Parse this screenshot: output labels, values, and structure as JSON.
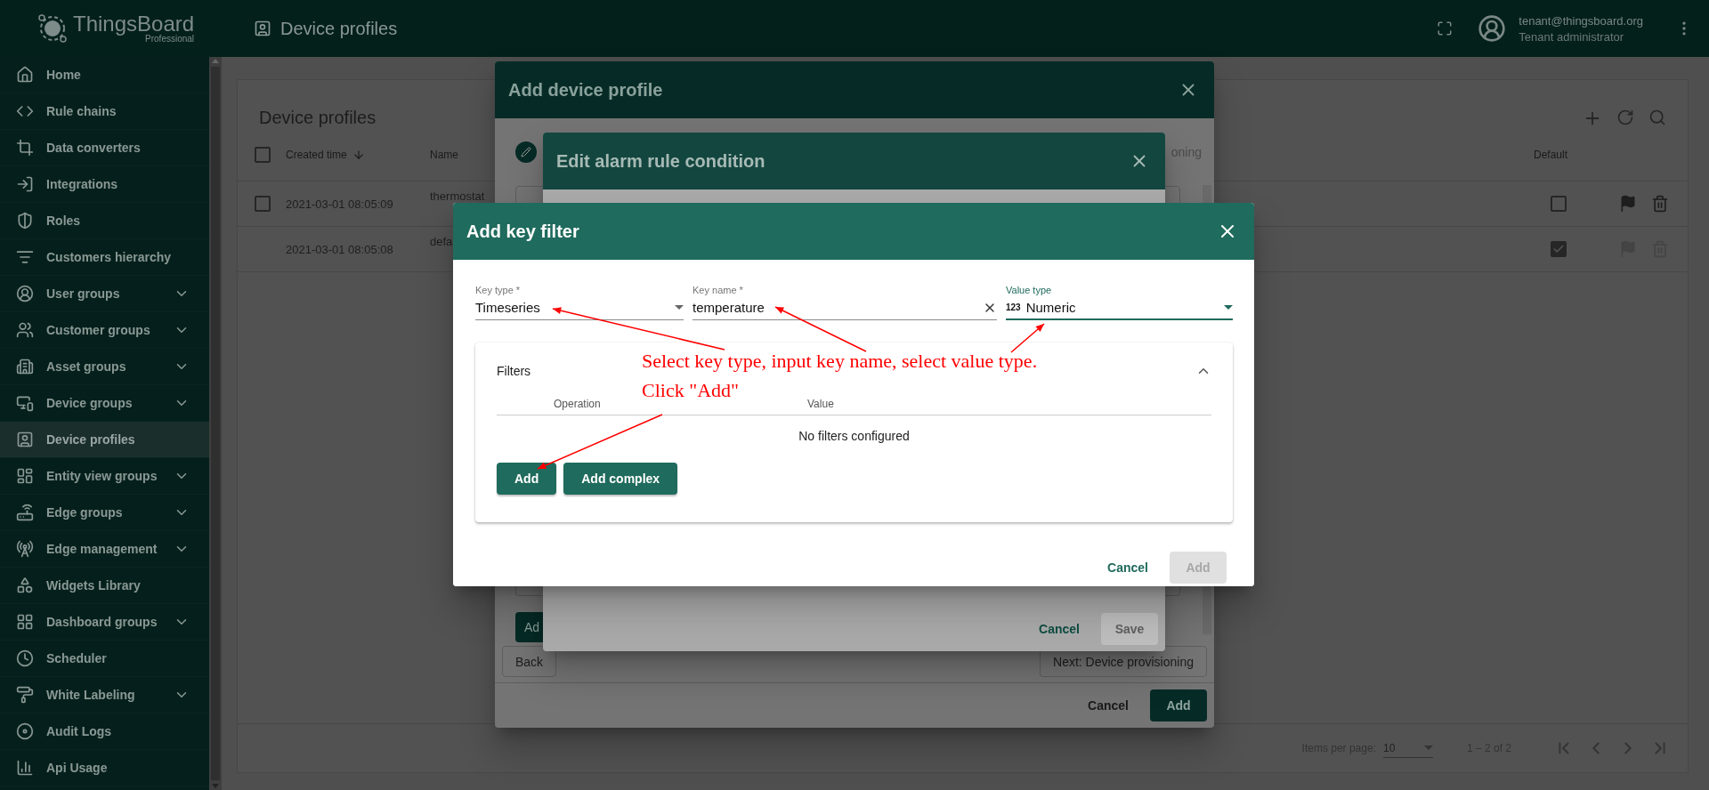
{
  "app": {
    "logo": "ThingsBoard",
    "edition": "Professional",
    "page_title": "Device profiles"
  },
  "user": {
    "email": "tenant@thingsboard.org",
    "role": "Tenant administrator"
  },
  "sidebar": {
    "items": [
      {
        "label": "Home",
        "expandable": false,
        "selected": false
      },
      {
        "label": "Rule chains",
        "expandable": false,
        "selected": false
      },
      {
        "label": "Data converters",
        "expandable": false,
        "selected": false
      },
      {
        "label": "Integrations",
        "expandable": false,
        "selected": false
      },
      {
        "label": "Roles",
        "expandable": false,
        "selected": false
      },
      {
        "label": "Customers hierarchy",
        "expandable": false,
        "selected": false
      },
      {
        "label": "User groups",
        "expandable": true,
        "selected": false
      },
      {
        "label": "Customer groups",
        "expandable": true,
        "selected": false
      },
      {
        "label": "Asset groups",
        "expandable": true,
        "selected": false
      },
      {
        "label": "Device groups",
        "expandable": true,
        "selected": false
      },
      {
        "label": "Device profiles",
        "expandable": false,
        "selected": true
      },
      {
        "label": "Entity view groups",
        "expandable": true,
        "selected": false
      },
      {
        "label": "Edge groups",
        "expandable": true,
        "selected": false
      },
      {
        "label": "Edge management",
        "expandable": true,
        "selected": false
      },
      {
        "label": "Widgets Library",
        "expandable": false,
        "selected": false
      },
      {
        "label": "Dashboard groups",
        "expandable": true,
        "selected": false
      },
      {
        "label": "Scheduler",
        "expandable": false,
        "selected": false
      },
      {
        "label": "White Labeling",
        "expandable": true,
        "selected": false
      },
      {
        "label": "Audit Logs",
        "expandable": false,
        "selected": false
      },
      {
        "label": "Api Usage",
        "expandable": false,
        "selected": false
      }
    ]
  },
  "table": {
    "title": "Device profiles",
    "columns": [
      "Created time",
      "Name",
      "Default"
    ],
    "all_checked": false,
    "rows": [
      {
        "checked": false,
        "created": "2021-03-01 08:05:09",
        "name": "thermostat",
        "selectable": true,
        "default": false,
        "actions_disabled": false
      },
      {
        "created": "2021-03-01 08:05:08",
        "name": "defa",
        "selectable": false,
        "default": true,
        "actions_disabled": true
      }
    ]
  },
  "pagination": {
    "label": "Items per page:",
    "page_size": "10",
    "range": "1 – 2 of 2"
  },
  "device_profile_dialog": {
    "title": "Add device profile",
    "step_label": "oning",
    "add_partial": "Ad",
    "back": "Back",
    "next": "Next: Device provisioning",
    "cancel": "Cancel",
    "add": "Add"
  },
  "condition_dialog": {
    "title": "Edit alarm rule condition",
    "cancel": "Cancel",
    "save": "Save",
    "save_disabled": true
  },
  "key_filter_dialog": {
    "title": "Add key filter",
    "key_type": {
      "label": "Key type *",
      "value": "Timeseries"
    },
    "key_name": {
      "label": "Key name *",
      "value": "temperature"
    },
    "value_type": {
      "label": "Value type",
      "icon_text": "123",
      "value": "Numeric",
      "focused": true
    },
    "filters": {
      "title": "Filters",
      "expanded": true,
      "columns": [
        "Operation",
        "Value"
      ],
      "empty": "No filters configured",
      "buttons": [
        "Add",
        "Add complex"
      ]
    },
    "cancel": "Cancel",
    "add": "Add",
    "add_disabled": true
  },
  "annotation": {
    "lines": [
      "Select key type, input key name, select value type.",
      "Click \"Add\""
    ]
  }
}
